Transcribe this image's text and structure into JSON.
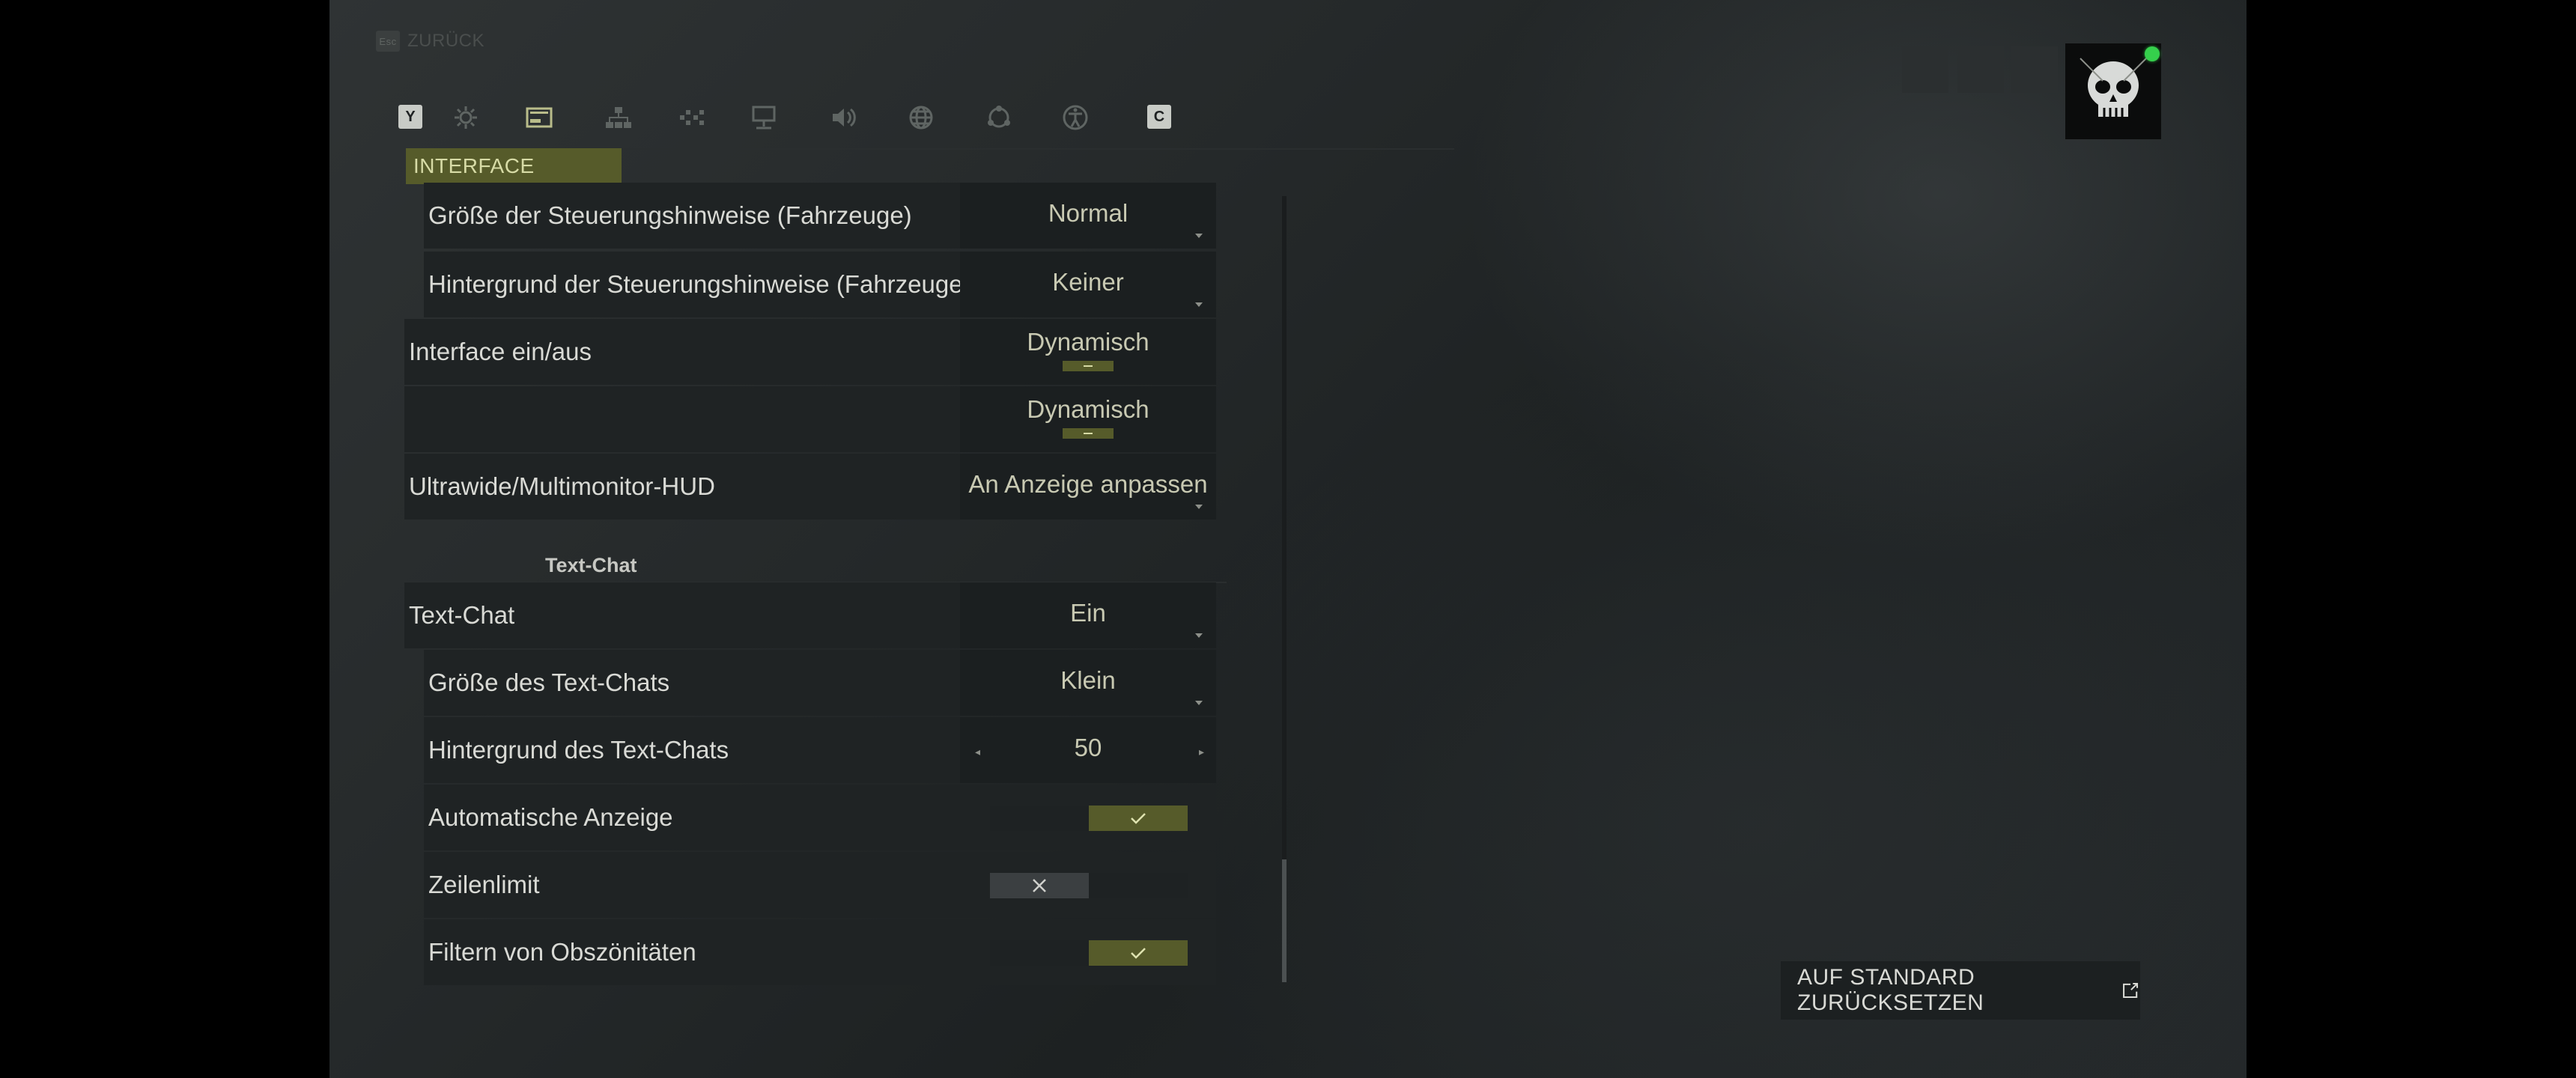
{
  "header": {
    "back_key": "Esc",
    "back_label": "ZURÜCK"
  },
  "tabs": {
    "left_key": "Y",
    "right_key": "C",
    "active_label": "INTERFACE",
    "icons": [
      "gear-icon",
      "interface-icon",
      "network-icon",
      "controller-icon",
      "display-icon",
      "audio-icon",
      "language-icon",
      "social-icon",
      "accessibility-icon"
    ]
  },
  "settings": {
    "rows": [
      {
        "label": "Größe der Steuerungshinweise (Fahrzeuge)",
        "value": "Normal"
      },
      {
        "label": "Hintergrund der Steuerungshinweise (Fahrzeuge)",
        "value": "Keiner"
      },
      {
        "label": "Interface ein/aus",
        "value": "Dynamisch"
      },
      {
        "label": "",
        "value": "Dynamisch"
      },
      {
        "label": "Ultrawide/Multimonitor-HUD",
        "value": "An Anzeige anpassen"
      }
    ],
    "section_title": "Text-Chat",
    "chat_rows": [
      {
        "label": "Text-Chat",
        "value": "Ein"
      },
      {
        "label": "Größe des Text-Chats",
        "value": "Klein"
      },
      {
        "label": "Hintergrund des Text-Chats",
        "value": "50"
      },
      {
        "label": "Automatische Anzeige",
        "value": "on"
      },
      {
        "label": "Zeilenlimit",
        "value": "off"
      },
      {
        "label": "Filtern von Obszönitäten",
        "value": "on"
      }
    ]
  },
  "footer": {
    "reset_label": "AUF STANDARD ZURÜCKSETZEN"
  },
  "colors": {
    "accent": "#565b2a",
    "accent_text": "#d7dba6",
    "online": "#35d04c"
  }
}
